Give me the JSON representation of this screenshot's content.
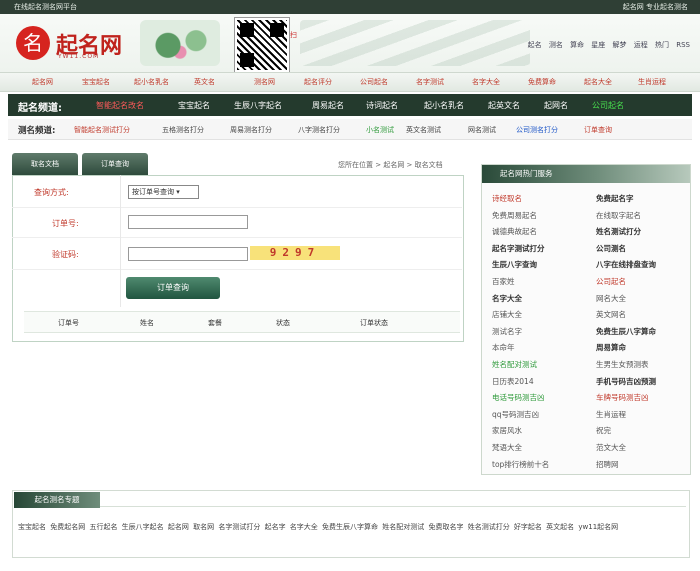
{
  "topbar": {
    "left": "在线起名测名网平台",
    "right": "起名网 专业起名测名"
  },
  "brand": {
    "logo_glyph": "名",
    "name": "起名网",
    "sub": "YW11.COM"
  },
  "qr_note": "扫",
  "top_links": [
    "起名",
    "测名",
    "算命",
    "星座",
    "解梦",
    "运程",
    "热门",
    "RSS"
  ],
  "nav_main": [
    "起名网",
    "宝宝起名",
    "起小名乳名",
    "英文名",
    "测名网",
    "起名评分",
    "公司起名",
    "名字测试",
    "名字大全",
    "免费算命",
    "起名大全",
    "生肖运程"
  ],
  "channel": {
    "title": "起名频道:",
    "items": [
      {
        "label": "智能起名改名",
        "color": "#ff5a5a"
      },
      {
        "label": "宝宝起名",
        "color": "#ffffff"
      },
      {
        "label": "生辰八字起名",
        "color": "#ffffff"
      },
      {
        "label": "周易起名",
        "color": "#ffffff"
      },
      {
        "label": "诗词起名",
        "color": "#ffffff"
      },
      {
        "label": "起小名乳名",
        "color": "#ffffff"
      },
      {
        "label": "起英文名",
        "color": "#ffffff"
      },
      {
        "label": "起网名",
        "color": "#ffffff"
      },
      {
        "label": "公司起名",
        "color": "#48e04e"
      }
    ]
  },
  "test_channel": {
    "title": "测名频道:",
    "items": [
      {
        "label": "智能起名测试打分",
        "color": "#c0392b"
      },
      {
        "label": "五格测名打分",
        "color": "#444444"
      },
      {
        "label": "周易测名打分",
        "color": "#444444"
      },
      {
        "label": "八字测名打分",
        "color": "#444444"
      },
      {
        "label": "小名测试",
        "color": "#2e9a3a"
      },
      {
        "label": "英文名测试",
        "color": "#444444"
      },
      {
        "label": "网名测试",
        "color": "#444444"
      },
      {
        "label": "公司测名打分",
        "color": "#1c55c7"
      },
      {
        "label": "订单查询",
        "color": "#c0392b"
      }
    ]
  },
  "tabs": [
    "取名文档",
    "订单查询"
  ],
  "breadcrumb": "您所在位置 > 起名网 > 取名文档",
  "form": {
    "method_label": "查询方式:",
    "method_value": "按订单号查询 ▾",
    "order_label": "订单号:",
    "captcha_label": "验证码:",
    "captcha_code": "9297",
    "submit_label": "订单查询"
  },
  "table_headers": [
    "订单号",
    "姓名",
    "套餐",
    "状态",
    "订单状态"
  ],
  "sidebar": {
    "title": "起名网热门服务",
    "items": [
      {
        "label": "诗经取名",
        "color": "#c0392b",
        "bold": false
      },
      {
        "label": "免费起名字",
        "color": "#333333",
        "bold": true
      },
      {
        "label": "免费周易起名",
        "color": "#555555",
        "bold": false
      },
      {
        "label": "在线取字起名",
        "color": "#555555",
        "bold": false
      },
      {
        "label": "诚德典故起名",
        "color": "#555555",
        "bold": false
      },
      {
        "label": "姓名测试打分",
        "color": "#333333",
        "bold": true
      },
      {
        "label": "起名字测试打分",
        "color": "#333333",
        "bold": true
      },
      {
        "label": "公司测名",
        "color": "#333333",
        "bold": true
      },
      {
        "label": "生辰八字查询",
        "color": "#333333",
        "bold": true
      },
      {
        "label": "八字在线排盘查询",
        "color": "#333333",
        "bold": true
      },
      {
        "label": "百家姓",
        "color": "#555555",
        "bold": false
      },
      {
        "label": "公司起名",
        "color": "#c0392b",
        "bold": false
      },
      {
        "label": "名字大全",
        "color": "#333333",
        "bold": true
      },
      {
        "label": "网名大全",
        "color": "#555555",
        "bold": false
      },
      {
        "label": "店铺大全",
        "color": "#555555",
        "bold": false
      },
      {
        "label": "英文网名",
        "color": "#555555",
        "bold": false
      },
      {
        "label": "测试名字",
        "color": "#555555",
        "bold": false
      },
      {
        "label": "免费生辰八字算命",
        "color": "#333333",
        "bold": true
      },
      {
        "label": "本命年",
        "color": "#555555",
        "bold": false
      },
      {
        "label": "周易算命",
        "color": "#333333",
        "bold": true
      },
      {
        "label": "姓名配对测试",
        "color": "#2e9a3a",
        "bold": false
      },
      {
        "label": "生男生女预测表",
        "color": "#555555",
        "bold": false
      },
      {
        "label": "日历表2014",
        "color": "#555555",
        "bold": false
      },
      {
        "label": "手机号码吉凶预测",
        "color": "#333333",
        "bold": true
      },
      {
        "label": "电话号码测吉凶",
        "color": "#2e9a3a",
        "bold": false
      },
      {
        "label": "车牌号码测吉凶",
        "color": "#c0392b",
        "bold": false
      },
      {
        "label": "qq号码测吉凶",
        "color": "#555555",
        "bold": false
      },
      {
        "label": "生肖运程",
        "color": "#555555",
        "bold": false
      },
      {
        "label": "家居风水",
        "color": "#555555",
        "bold": false
      },
      {
        "label": "祝完",
        "color": "#555555",
        "bold": false
      },
      {
        "label": "梵语大全",
        "color": "#555555",
        "bold": false
      },
      {
        "label": "范文大全",
        "color": "#555555",
        "bold": false
      },
      {
        "label": "top排行榜前十名",
        "color": "#555555",
        "bold": false
      },
      {
        "label": "招聘网",
        "color": "#555555",
        "bold": false
      }
    ]
  },
  "hot": {
    "title": "起名测名专题",
    "text": "宝宝起名 免费起名网 五行起名 生辰八字起名 起名网 取名网 名字测试打分 起名字 名字大全 免费生辰八字算命 姓名配对测试 免费取名字 姓名测试打分 好字起名 英文起名 yw11起名网"
  }
}
